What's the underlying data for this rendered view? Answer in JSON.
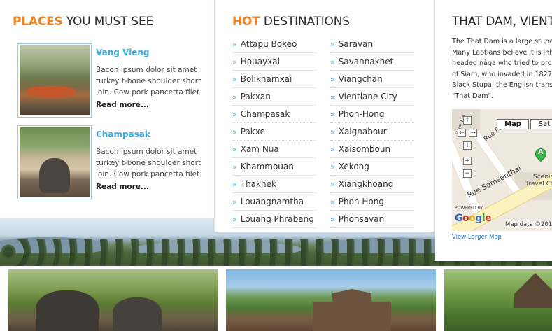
{
  "places_section": {
    "heading_highlight": "PLACES",
    "heading_rest": " YOU MUST SEE",
    "items": [
      {
        "title": "Vang Vieng",
        "text": "Bacon ipsum dolor sit amet turkey t-bone shoulder short loin. Cow pork pancetta filet ...",
        "more": "Read more..."
      },
      {
        "title": "Champasak",
        "text": "Bacon ipsum dolor sit amet turkey t-bone shoulder short loin. Cow pork pancetta filet ...",
        "more": "Read more..."
      }
    ]
  },
  "destinations_section": {
    "heading_highlight": "HOT",
    "heading_rest": " DESTINATIONS",
    "arrow": "»",
    "left": [
      "Attapu Bokeo",
      "Houayxai",
      "Bolikhamxai",
      "Pakxan",
      "Champasak",
      "Pakxe",
      "Xam Nua",
      "Khammouan",
      "Thakhek",
      "Louangnamtha",
      "Louang Phrabang"
    ],
    "right": [
      "Saravan",
      "Savannakhet",
      "Viangchan",
      "Vientiane City",
      "Phon-Hong",
      "Xaignabouri",
      "Xaisomboun",
      "Xekong",
      "Xiangkhoang",
      "Phon Hong",
      "Phonsavan"
    ]
  },
  "feature_section": {
    "heading": "THAT DAM, VIENT",
    "description_lines": [
      "The That Dam is a large stupa",
      "Many Laotians believe it is inh",
      "headed nâga who tried to prot",
      "of Siam, who invaded in 1827.",
      "Black Stupa, the English transl",
      "\"That Dam\"."
    ],
    "map": {
      "tab_map": "Map",
      "tab_sat": "Sat",
      "road_main": "Rue Samsenthai",
      "road_2": "Rue Le",
      "road_3": "Rue Pa",
      "place_label_1": "Scenic",
      "place_label_2": "Travel Co.",
      "marker": "A",
      "powered_by": "POWERED BY",
      "google": [
        "G",
        "o",
        "o",
        "g",
        "l",
        "e"
      ],
      "map_data": "Map data ©201",
      "ctrl_up": "↑",
      "ctrl_left": "←",
      "ctrl_right": "→",
      "ctrl_down": "↓",
      "ctrl_zoom_in": "+",
      "ctrl_zoom_out": "−"
    },
    "larger_map_link": "View Larger Map"
  },
  "colors": {
    "accent_orange": "#f58220",
    "link_blue": "#3eaad8"
  }
}
